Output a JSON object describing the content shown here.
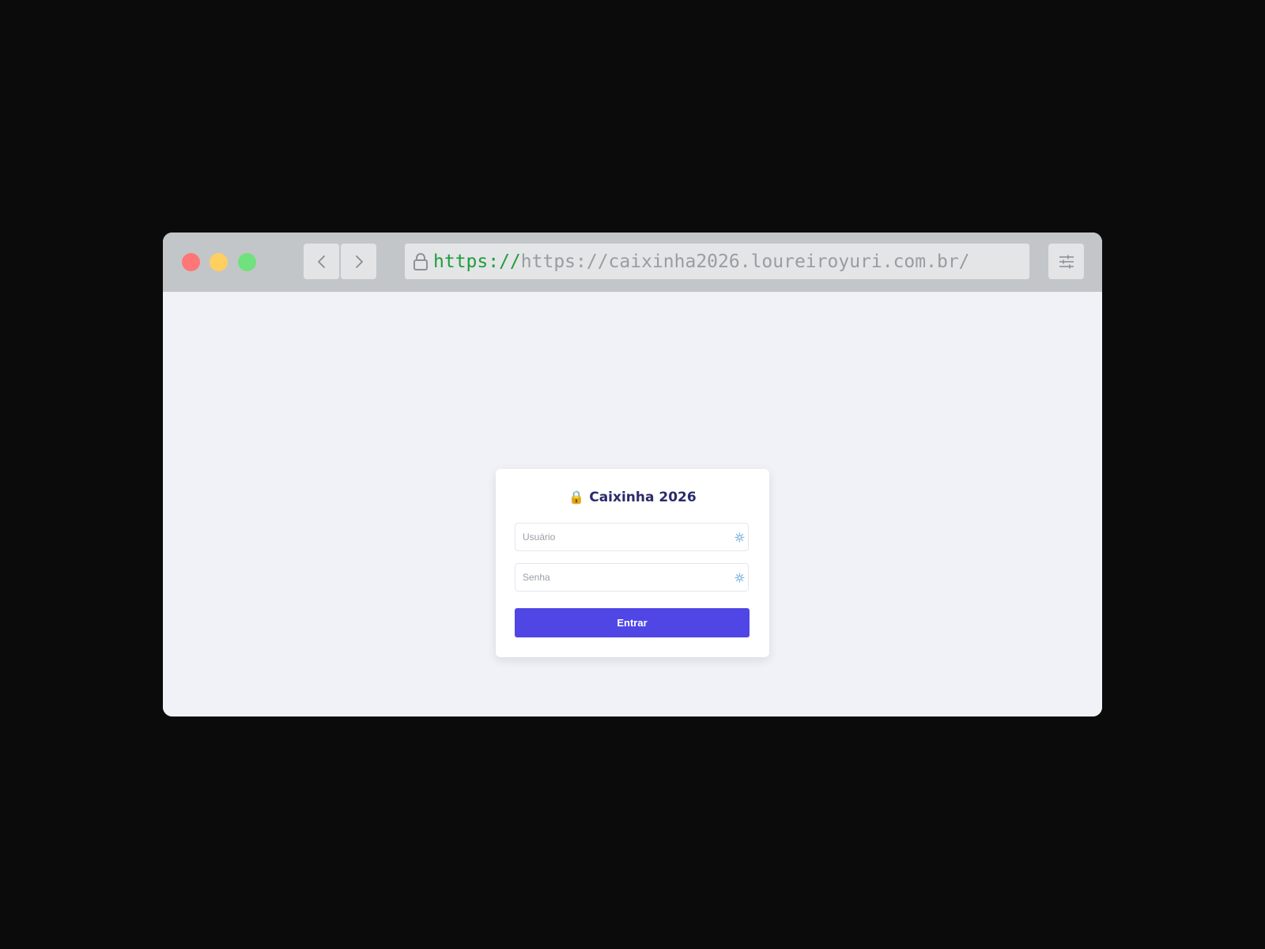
{
  "browser": {
    "url_scheme": "https://",
    "url_rest": "https://caixinha2026.loureiroyuri.com.br/"
  },
  "login": {
    "title_icon": "🔒",
    "title": "Caixinha 2026",
    "username_placeholder": "Usuário",
    "password_placeholder": "Senha",
    "submit_label": "Entrar"
  },
  "colors": {
    "accent": "#4f46e5",
    "title": "#2b2a6b",
    "url_scheme": "#1f9d3a",
    "background": "#f0f2f7"
  },
  "icons": {
    "lock": "lock-icon",
    "back": "chevron-left-icon",
    "forward": "chevron-right-icon",
    "menu": "sliders-icon",
    "autofill": "sparkle-icon"
  }
}
